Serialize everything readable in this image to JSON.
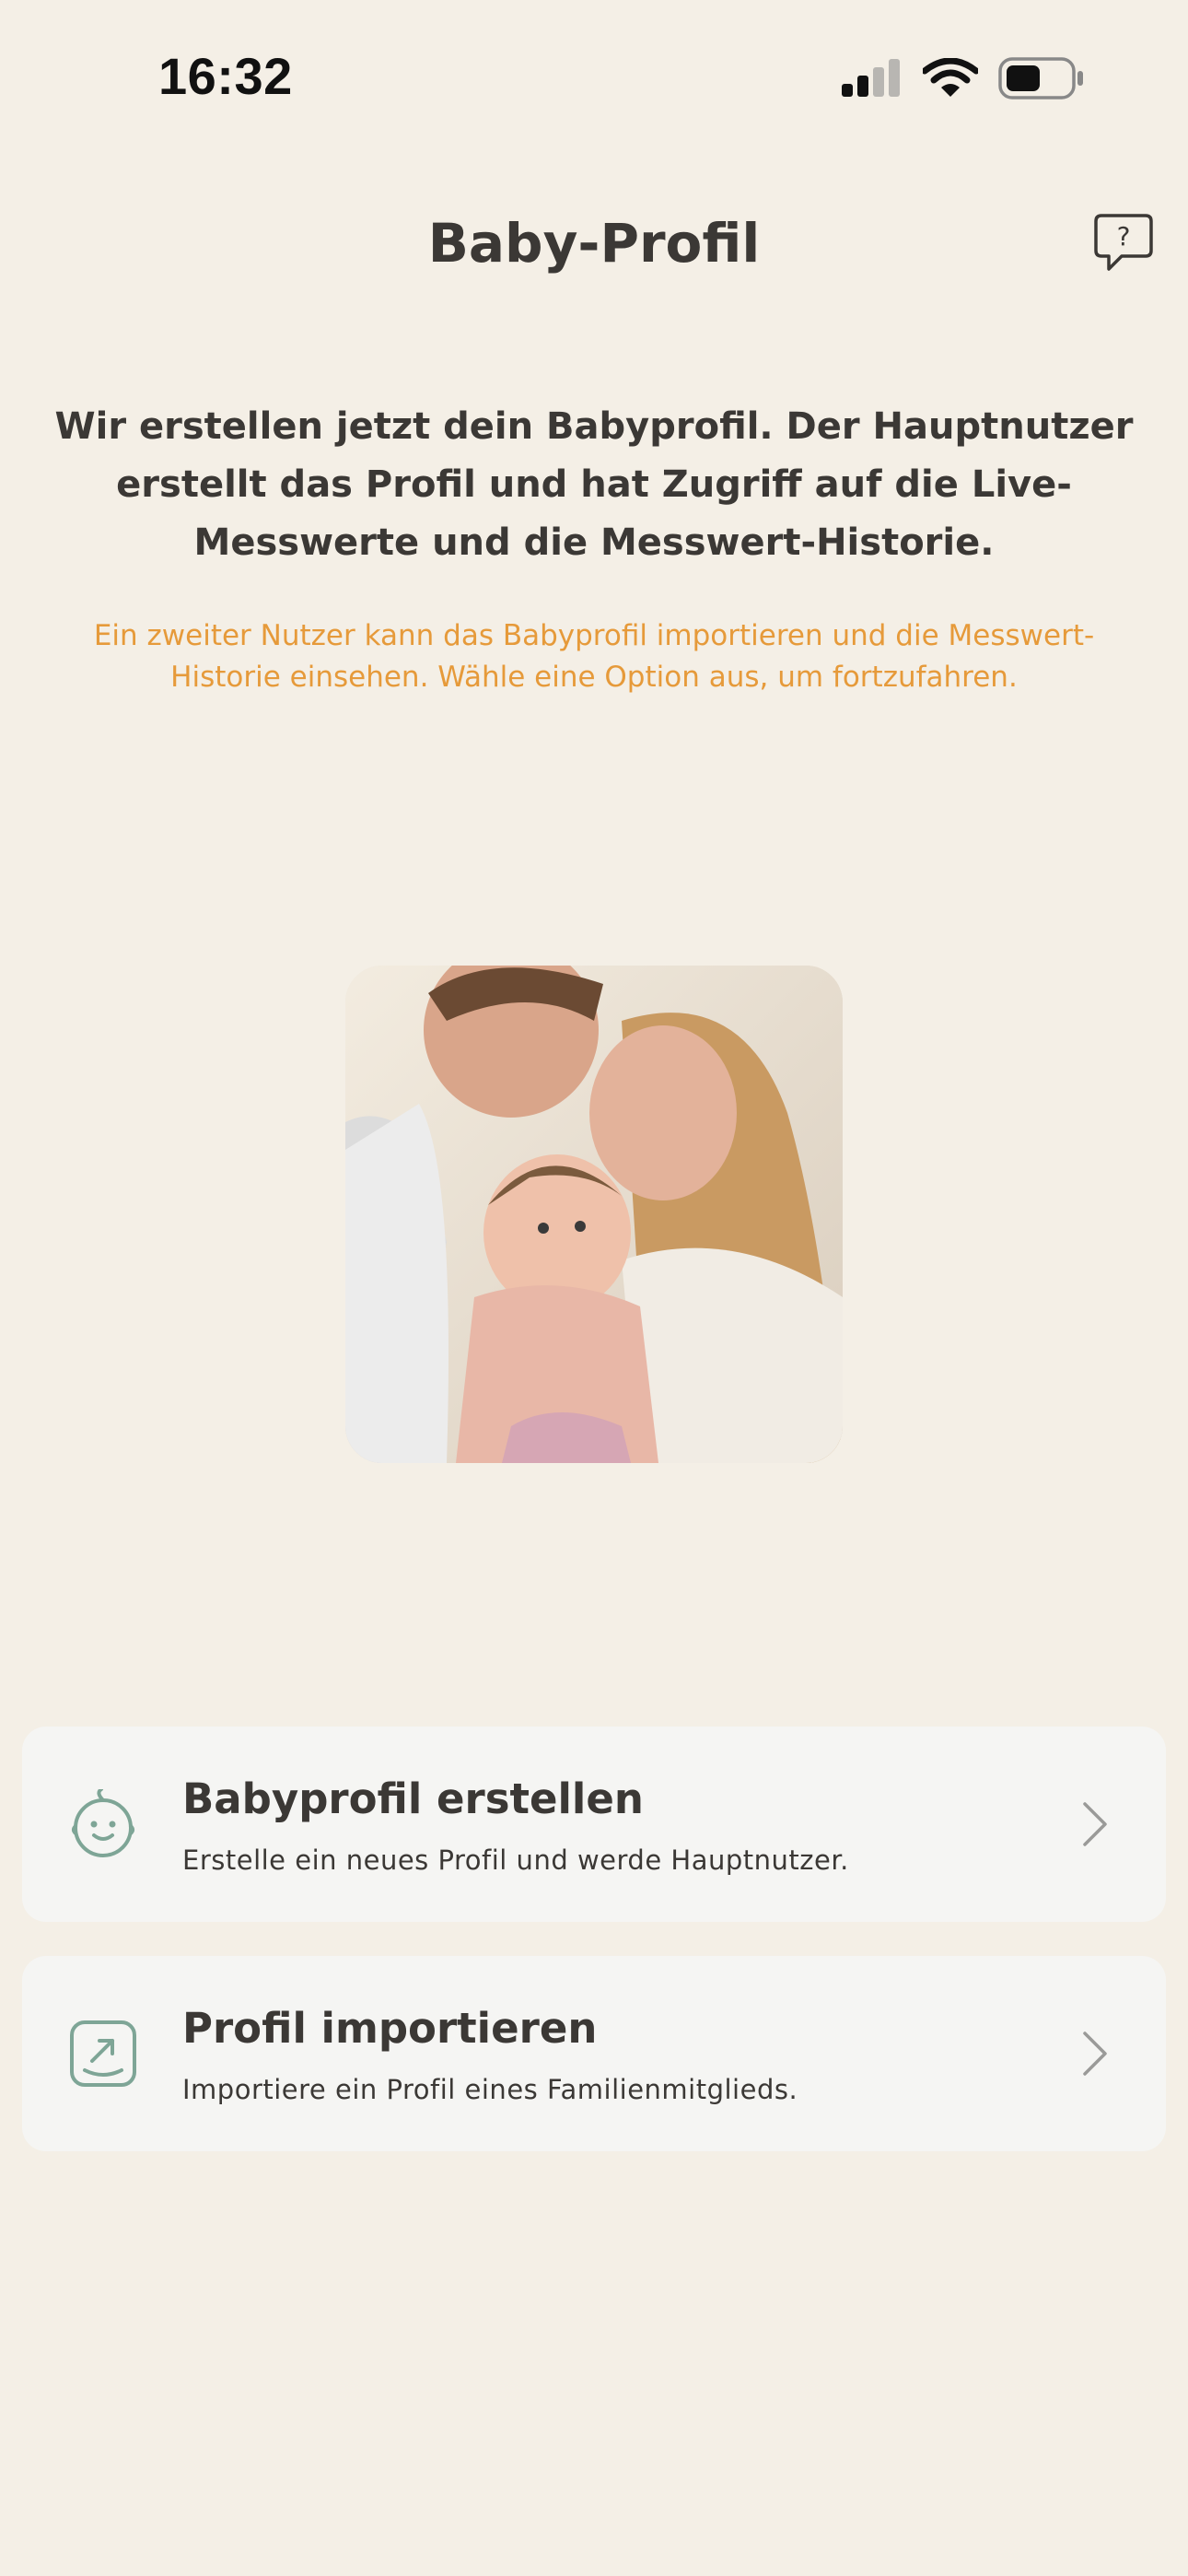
{
  "status_bar": {
    "time": "16:32",
    "icons": [
      "cellular-signal-icon",
      "wifi-icon",
      "battery-icon"
    ]
  },
  "header": {
    "title": "Baby-Profil",
    "help_icon": "help-bubble-icon",
    "help_glyph": "?"
  },
  "intro": {
    "text": "Wir erstellen jetzt dein Babyprofil. Der Hauptnutzer erstellt das Profil und hat Zugriff auf die Live-Messwerte und die Messwert-Historie.",
    "note": "Ein zweiter Nutzer kann das Babyprofil importieren und die Messwert-Historie einsehen. Wähle eine Option aus, um fortzufahren."
  },
  "options": [
    {
      "icon": "baby-face-icon",
      "title": "Babyprofil erstellen",
      "subtitle": "Erstelle ein neues Profil und werde Hauptnutzer."
    },
    {
      "icon": "import-icon",
      "title": "Profil importieren",
      "subtitle": "Importiere ein Profil eines Familienmitglieds."
    }
  ],
  "colors": {
    "background": "#f4efe6",
    "card": "#f5f5f3",
    "text": "#3b3835",
    "accent": "#e69a3a",
    "icon": "#7ea596"
  }
}
